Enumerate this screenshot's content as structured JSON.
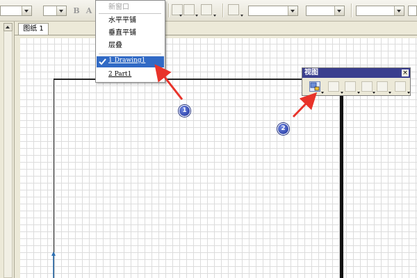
{
  "sheet_tab": {
    "label": "图纸 1"
  },
  "toolbar": {
    "bold_label": "B",
    "italic_label": "A"
  },
  "window_menu": {
    "new_window": "新窗口",
    "tile_horizontal": "水平平铺",
    "tile_vertical": "垂直平铺",
    "cascade": "层叠",
    "documents": [
      {
        "label": "1 Drawing1",
        "selected": true
      },
      {
        "label": "2 Part1",
        "selected": false
      }
    ]
  },
  "view_toolbar": {
    "title": "视图",
    "close_glyph": "×"
  },
  "annotations": [
    {
      "number": "1"
    },
    {
      "number": "2"
    }
  ],
  "colors": {
    "menu_highlight": "#316ac5",
    "toolbar_title": "#3a3e8e",
    "annotation_arrow": "#e8332a",
    "marker": "#1a2f9a"
  }
}
